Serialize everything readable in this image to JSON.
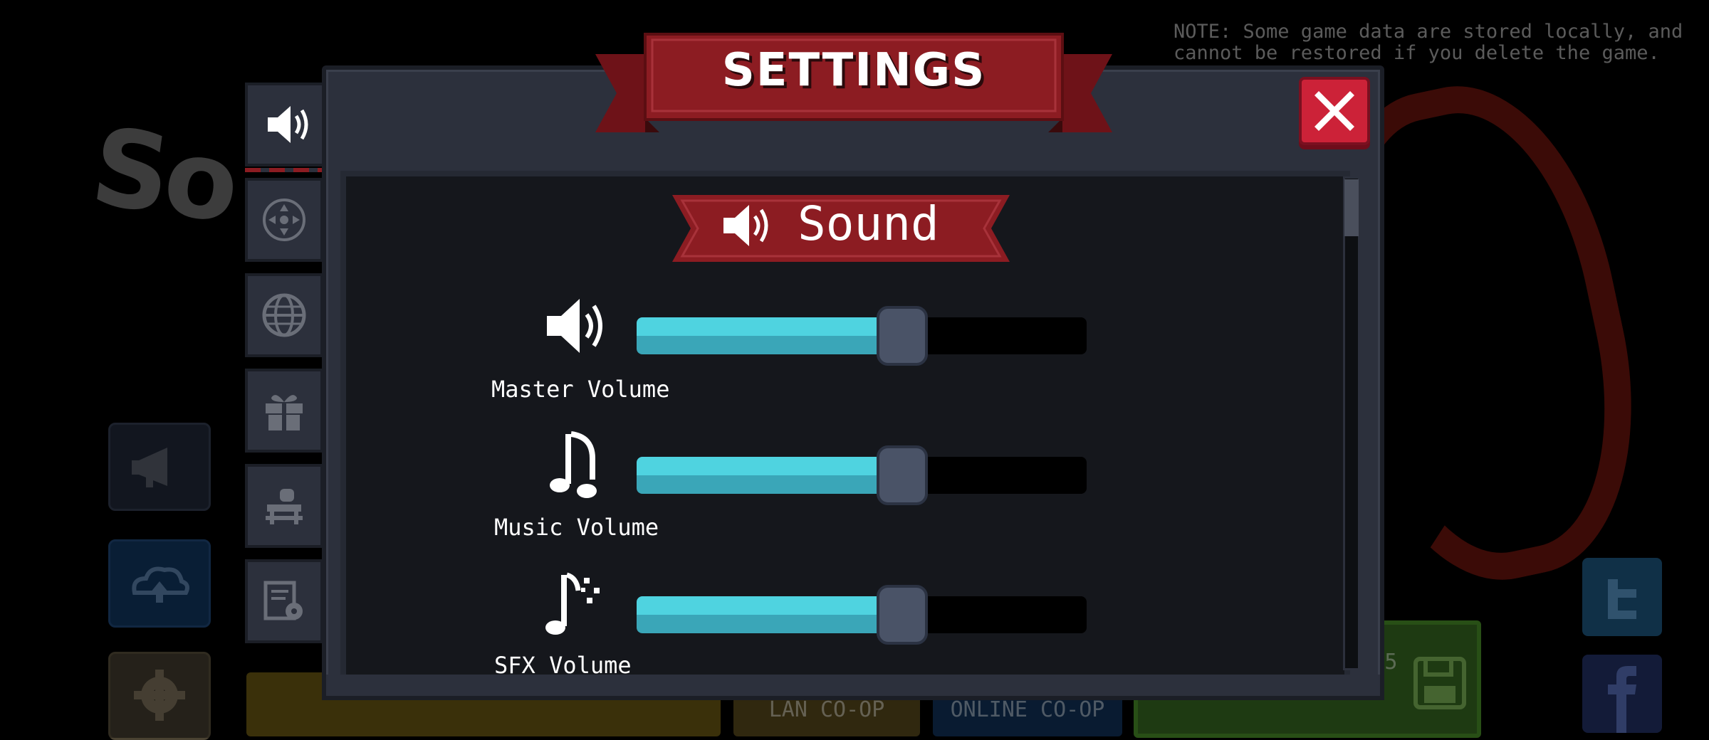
{
  "background": {
    "logo_fragment": "So",
    "note": "NOTE: Some game data are stored locally, and\ncannot be restored if you delete the game.",
    "bottom_buttons": [
      {
        "label": ""
      },
      {
        "label": "LAN CO-OP"
      },
      {
        "label": "ONLINE CO-OP"
      },
      {
        "label": "LEVEL MODE 2-5"
      }
    ],
    "side_buttons": [
      "megaphone-icon",
      "cloud-upload-icon",
      "gear-icon"
    ],
    "social": [
      "twitter-icon",
      "facebook-icon"
    ],
    "save_icon": "save-icon"
  },
  "dialog": {
    "title": "SETTINGS",
    "close_icon": "close-icon",
    "tabs": [
      {
        "icon": "speaker-icon",
        "active": true
      },
      {
        "icon": "move-controls-icon",
        "active": false
      },
      {
        "icon": "globe-icon",
        "active": false
      },
      {
        "icon": "gift-icon",
        "active": false
      },
      {
        "icon": "bench-icon",
        "active": false
      },
      {
        "icon": "document-settings-icon",
        "active": false
      }
    ],
    "section": {
      "title": "Sound",
      "icon": "speaker-icon"
    },
    "sliders": [
      {
        "label": "Master Volume",
        "icon": "speaker-icon",
        "value": 0.59
      },
      {
        "label": "Music Volume",
        "icon": "music-note-icon",
        "value": 0.59
      },
      {
        "label": "SFX Volume",
        "icon": "sfx-icon",
        "value": 0.59
      }
    ]
  },
  "colors": {
    "banner_red": "#8c1c22",
    "slider_fill": "#4fd3e0",
    "close_red": "#cc2238",
    "panel": "#2c303c"
  }
}
